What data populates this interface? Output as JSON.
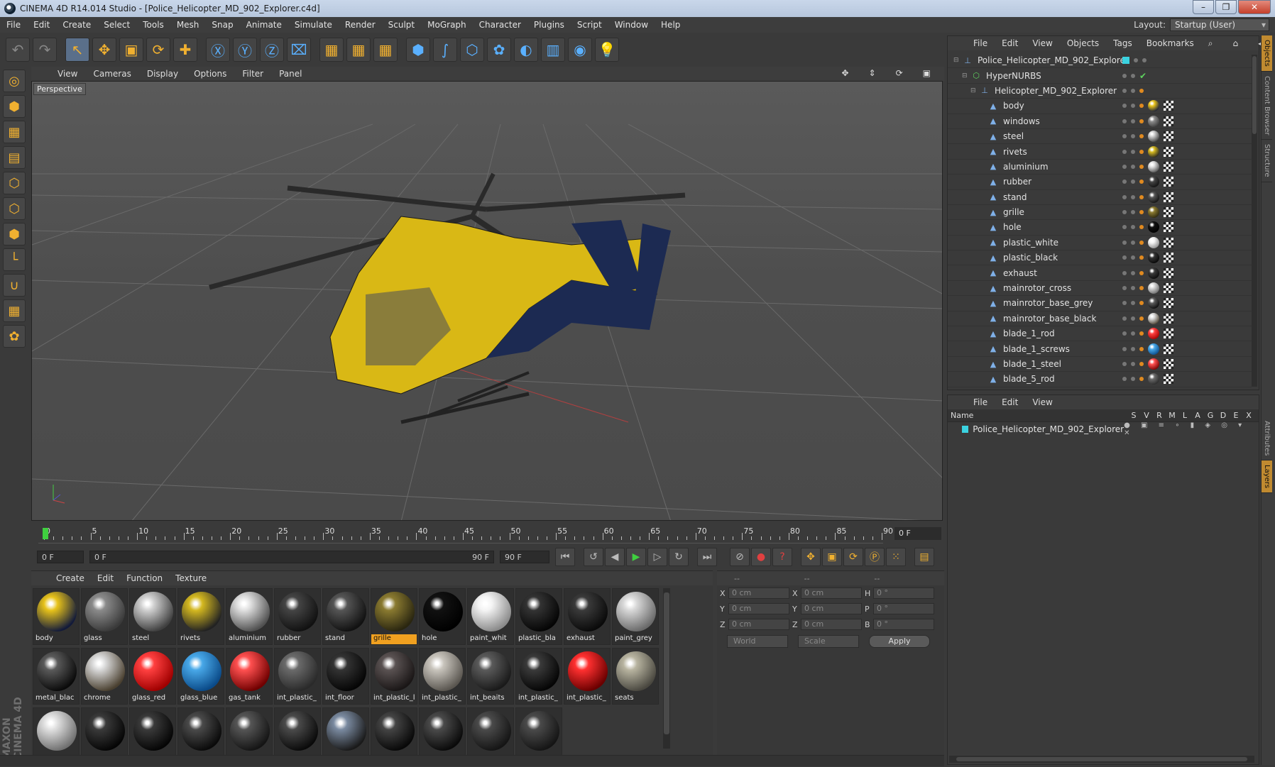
{
  "window": {
    "title": "CINEMA 4D R14.014 Studio - [Police_Helicopter_MD_902_Explorer.c4d]"
  },
  "menu": [
    "File",
    "Edit",
    "Create",
    "Select",
    "Tools",
    "Mesh",
    "Snap",
    "Animate",
    "Simulate",
    "Render",
    "Sculpt",
    "MoGraph",
    "Character",
    "Plugins",
    "Script",
    "Window",
    "Help"
  ],
  "layout": {
    "label": "Layout:",
    "value": "Startup (User)"
  },
  "toolbar_icons": [
    "undo-icon",
    "redo-icon",
    "live-select-icon",
    "move-icon",
    "scale-icon",
    "rotate-icon",
    "add-icon",
    "x-axis-icon",
    "y-axis-icon",
    "z-axis-icon",
    "coordinate-system-icon",
    "render-view-icon",
    "render-picture-viewer-icon",
    "edit-render-settings-icon",
    "cube-icon",
    "spline-pen-icon",
    "subdivision-icon",
    "mograph-cloner-icon",
    "deformer-icon",
    "floor-icon",
    "camera-icon",
    "light-icon"
  ],
  "left_tools": [
    "make-editable-icon",
    "model-mode-icon",
    "texture-mode-icon",
    "workplane-mode-icon",
    "points-mode-icon",
    "edges-mode-icon",
    "polygons-mode-icon",
    "axis-mode-icon",
    "magnet-icon",
    "snapping-icon",
    "soft-selection-icon"
  ],
  "viewport": {
    "menu": [
      "View",
      "Cameras",
      "Display",
      "Options",
      "Filter",
      "Panel"
    ],
    "label": "Perspective"
  },
  "timeline": {
    "ticks": [
      "0",
      "5",
      "10",
      "15",
      "20",
      "25",
      "30",
      "35",
      "40",
      "45",
      "50",
      "55",
      "60",
      "65",
      "70",
      "75",
      "80",
      "85",
      "90"
    ],
    "current_frame": "0 F"
  },
  "transport": {
    "start": "0 F",
    "range_start": "0 F",
    "range_end": "90 F",
    "end": "90 F"
  },
  "materials": {
    "menu": [
      "Create",
      "Edit",
      "Function",
      "Texture"
    ],
    "items": [
      {
        "name": "body",
        "c1": "#e7c21a",
        "c2": "#121a3a"
      },
      {
        "name": "glass",
        "c1": "#8a8a8a",
        "c2": "#3a3a3a"
      },
      {
        "name": "steel",
        "c1": "#d0d0d0",
        "c2": "#404040"
      },
      {
        "name": "rivets",
        "c1": "#d4b820",
        "c2": "#222"
      },
      {
        "name": "aluminium",
        "c1": "#e0e0e0",
        "c2": "#505050"
      },
      {
        "name": "rubber",
        "c1": "#444",
        "c2": "#111"
      },
      {
        "name": "stand",
        "c1": "#555",
        "c2": "#111"
      },
      {
        "name": "grille",
        "c1": "#8a7a30",
        "c2": "#2a2610"
      },
      {
        "name": "hole",
        "c1": "#111",
        "c2": "#000"
      },
      {
        "name": "paint_whit",
        "c1": "#f4f4f4",
        "c2": "#8a8a8a"
      },
      {
        "name": "plastic_bla",
        "c1": "#333",
        "c2": "#050505"
      },
      {
        "name": "exhaust",
        "c1": "#3a3a3a",
        "c2": "#0a0a0a"
      },
      {
        "name": "paint_grey",
        "c1": "#d8d8d8",
        "c2": "#6a6a6a"
      },
      {
        "name": "metal_blac",
        "c1": "#5a5a5a",
        "c2": "#0a0a0a"
      },
      {
        "name": "chrome",
        "c1": "#d8d8d8",
        "c2": "#4a4030"
      },
      {
        "name": "glass_red",
        "c1": "#ff4040",
        "c2": "#a00000"
      },
      {
        "name": "glass_blue",
        "c1": "#48a8e8",
        "c2": "#0a4a88"
      },
      {
        "name": "gas_tank",
        "c1": "#ff5050",
        "c2": "#700000"
      },
      {
        "name": "int_plastic_",
        "c1": "#6a6a6a",
        "c2": "#2a2a2a"
      },
      {
        "name": "int_floor",
        "c1": "#333",
        "c2": "#050505"
      },
      {
        "name": "int_plastic_l",
        "c1": "#5a5252",
        "c2": "#1a1616"
      },
      {
        "name": "int_plastic_",
        "c1": "#c8c4bc",
        "c2": "#5a5650"
      },
      {
        "name": "int_beaits",
        "c1": "#5a5a5a",
        "c2": "#1a1a1a"
      },
      {
        "name": "int_plastic_",
        "c1": "#3a3a3a",
        "c2": "#050505"
      },
      {
        "name": "int_plastic_",
        "c1": "#ff3030",
        "c2": "#6a0000"
      },
      {
        "name": "seats",
        "c1": "#b8b4a0",
        "c2": "#4a4840"
      },
      {
        "name": "",
        "c1": "#e0e0e0",
        "c2": "#707070"
      },
      {
        "name": "",
        "c1": "#3a3a3a",
        "c2": "#050505"
      },
      {
        "name": "",
        "c1": "#3a3a3a",
        "c2": "#050505"
      },
      {
        "name": "",
        "c1": "#4a4a4a",
        "c2": "#0a0a0a"
      },
      {
        "name": "",
        "c1": "#555",
        "c2": "#151515"
      },
      {
        "name": "",
        "c1": "#4a4a4a",
        "c2": "#0a0a0a"
      },
      {
        "name": "",
        "c1": "#7a8aa0",
        "c2": "#1a1a1a"
      },
      {
        "name": "",
        "c1": "#444",
        "c2": "#080808"
      },
      {
        "name": "",
        "c1": "#4a4a4a",
        "c2": "#0a0a0a"
      },
      {
        "name": "",
        "c1": "#4a4a4a",
        "c2": "#151515"
      },
      {
        "name": "",
        "c1": "#4a4a4a",
        "c2": "#151515"
      }
    ],
    "active_index": 7
  },
  "coordinates": {
    "header": [
      "--",
      "--",
      "--"
    ],
    "rows": [
      {
        "a": "X",
        "av": "0 cm",
        "b": "X",
        "bv": "0 cm",
        "c": "H",
        "cv": "0 °"
      },
      {
        "a": "Y",
        "av": "0 cm",
        "b": "Y",
        "bv": "0 cm",
        "c": "P",
        "cv": "0 °"
      },
      {
        "a": "Z",
        "av": "0 cm",
        "b": "Z",
        "bv": "0 cm",
        "c": "B",
        "cv": "0 °"
      }
    ],
    "world": "World",
    "scale": "Scale",
    "apply": "Apply"
  },
  "objects": {
    "menu": [
      "File",
      "Edit",
      "View",
      "Objects",
      "Tags",
      "Bookmarks"
    ],
    "items": [
      {
        "name": "Police_Helicopter_MD_902_Explorer",
        "indent": 0,
        "icon": "L0"
      },
      {
        "name": "HyperNURBS",
        "indent": 1,
        "icon": "HN"
      },
      {
        "name": "Helicopter_MD_902_Explorer",
        "indent": 2,
        "icon": "L0"
      },
      {
        "name": "body",
        "indent": 3,
        "icon": "▲"
      },
      {
        "name": "windows",
        "indent": 3,
        "icon": "▲"
      },
      {
        "name": "steel",
        "indent": 3,
        "icon": "▲"
      },
      {
        "name": "rivets",
        "indent": 3,
        "icon": "▲"
      },
      {
        "name": "aluminium",
        "indent": 3,
        "icon": "▲"
      },
      {
        "name": "rubber",
        "indent": 3,
        "icon": "▲"
      },
      {
        "name": "stand",
        "indent": 3,
        "icon": "▲"
      },
      {
        "name": "grille",
        "indent": 3,
        "icon": "▲"
      },
      {
        "name": "hole",
        "indent": 3,
        "icon": "▲"
      },
      {
        "name": "plastic_white",
        "indent": 3,
        "icon": "▲"
      },
      {
        "name": "plastic_black",
        "indent": 3,
        "icon": "▲"
      },
      {
        "name": "exhaust",
        "indent": 3,
        "icon": "▲"
      },
      {
        "name": "mainrotor_cross",
        "indent": 3,
        "icon": "▲"
      },
      {
        "name": "mainrotor_base_grey",
        "indent": 3,
        "icon": "▲"
      },
      {
        "name": "mainrotor_base_black",
        "indent": 3,
        "icon": "▲"
      },
      {
        "name": "blade_1_rod",
        "indent": 3,
        "icon": "▲"
      },
      {
        "name": "blade_1_screws",
        "indent": 3,
        "icon": "▲"
      },
      {
        "name": "blade_1_steel",
        "indent": 3,
        "icon": "▲"
      },
      {
        "name": "blade_5_rod",
        "indent": 3,
        "icon": "▲"
      }
    ]
  },
  "layers": {
    "menu": [
      "File",
      "Edit",
      "View"
    ],
    "name_col": "Name",
    "cols": [
      "S",
      "V",
      "R",
      "M",
      "L",
      "A",
      "G",
      "D",
      "E",
      "X"
    ],
    "rows": [
      {
        "name": "Police_Helicopter_MD_902_Explorer"
      }
    ]
  },
  "right_tabs": [
    "Objects",
    "Content Browser",
    "Structure",
    "Attributes",
    "Layers"
  ],
  "brand": {
    "maxon": "MAXON",
    "c4d": "CINEMA 4D"
  }
}
